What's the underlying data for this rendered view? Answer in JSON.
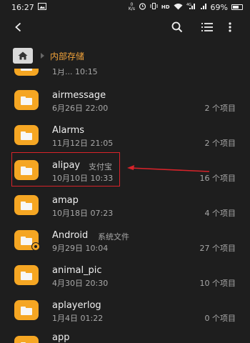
{
  "status_bar": {
    "time": "16:27",
    "net_speed_top": "0",
    "net_speed_bottom": "K/s",
    "hd_label": "HD",
    "signal_top": "4G",
    "battery_level": 0.69,
    "battery": "69%"
  },
  "app_bar": {
    "back_icon": "arrow-left-icon",
    "search_icon": "search-icon",
    "list_view_icon": "list-view-icon",
    "more_icon": "more-vert-icon"
  },
  "breadcrumb": {
    "home_icon": "home-icon",
    "current": "内部存储"
  },
  "files": [
    {
      "name": "airmessage",
      "alias": "",
      "date": "6月26日 22:00",
      "count": "2 个项目"
    },
    {
      "name": "Alarms",
      "alias": "",
      "date": "11月12日 21:05",
      "count": "2 个项目"
    },
    {
      "name": "alipay",
      "alias": "支付宝",
      "date": "10月10日 10:33",
      "count": "16 个项目"
    },
    {
      "name": "amap",
      "alias": "",
      "date": "10月18日 07:23",
      "count": "4 个项目"
    },
    {
      "name": "Android",
      "alias": "系统文件",
      "date": "9月29日 10:04",
      "count": "27 个项目"
    },
    {
      "name": "animal_pic",
      "alias": "",
      "date": "4月30日 20:30",
      "count": "10 个项目"
    },
    {
      "name": "aplayerlog",
      "alias": "",
      "date": "1月4日 01:22",
      "count": "0 个项目"
    },
    {
      "name": "app",
      "alias": "",
      "date": "",
      "count": ""
    }
  ],
  "partial_top_row": {
    "date": "1月... 10:15"
  },
  "annotation_color": "#d8232a",
  "accent_color": "#f5a623"
}
